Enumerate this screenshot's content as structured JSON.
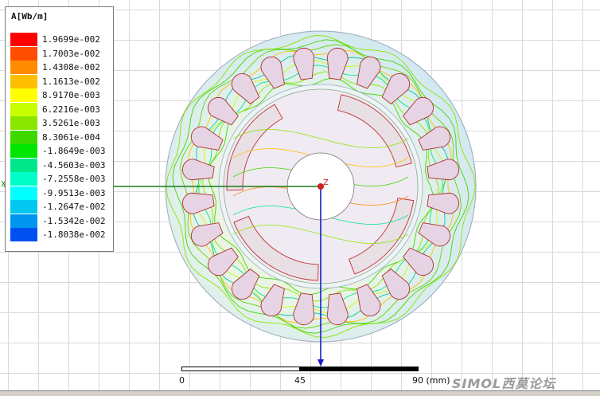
{
  "legend": {
    "title": "A[Wb/m]",
    "entries": [
      {
        "value": "1.9699e-002",
        "color": "#ff0000"
      },
      {
        "value": "1.7003e-002",
        "color": "#ff4d00"
      },
      {
        "value": "1.4308e-002",
        "color": "#ff8c00"
      },
      {
        "value": "1.1613e-002",
        "color": "#ffc000"
      },
      {
        "value": "8.9170e-003",
        "color": "#ffff00"
      },
      {
        "value": "6.2216e-003",
        "color": "#c8ff00"
      },
      {
        "value": "3.5261e-003",
        "color": "#8ae600"
      },
      {
        "value": "8.3061e-004",
        "color": "#3cd800"
      },
      {
        "value": "-1.8649e-003",
        "color": "#00e600"
      },
      {
        "value": "-4.5603e-003",
        "color": "#00e68a"
      },
      {
        "value": "-7.2558e-003",
        "color": "#00ffc8"
      },
      {
        "value": "-9.9513e-003",
        "color": "#00ffff"
      },
      {
        "value": "-1.2647e-002",
        "color": "#00c8f0"
      },
      {
        "value": "-1.5342e-002",
        "color": "#0096f0"
      },
      {
        "value": "-1.8038e-002",
        "color": "#0050f0"
      }
    ]
  },
  "scale_bar": {
    "tick_0": "0",
    "tick_mid": "45",
    "tick_end": "90 (mm)"
  },
  "axes": {
    "x_label": "X",
    "z_label": "Z"
  },
  "watermark": "SIMOL西莫论坛",
  "colors": {
    "stator": "#d8ecf4",
    "slot": "#e6d4e4",
    "rotor": "#f0e8f2",
    "magnet": "#e8e0e4",
    "axis_x": "#1a7a1a",
    "axis_y": "#1a1acc",
    "origin": "#cc2222"
  }
}
